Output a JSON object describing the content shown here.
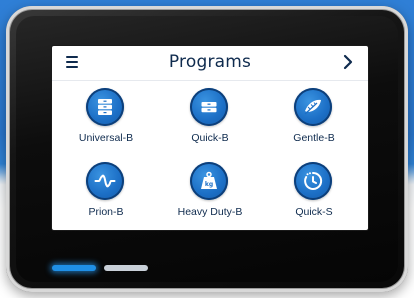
{
  "header": {
    "title": "Programs",
    "menu_icon": "menu-icon",
    "next_icon": "chevron-right-icon"
  },
  "programs": [
    {
      "label": "Universal-B",
      "icon": "universal-load-icon"
    },
    {
      "label": "Quick-B",
      "icon": "quick-load-icon"
    },
    {
      "label": "Gentle-B",
      "icon": "feather-icon"
    },
    {
      "label": "Prion-B",
      "icon": "prion-wave-icon"
    },
    {
      "label": "Heavy Duty-B",
      "icon": "weight-icon"
    },
    {
      "label": "Quick-S",
      "icon": "stopwatch-icon"
    }
  ],
  "page_indicator": {
    "pages": 2,
    "current": 1
  },
  "colors": {
    "accent": "#1c6fc6",
    "text": "#0f2b4e",
    "indicator_active": "#1f8fe6",
    "indicator_inactive": "#c9d0d8",
    "background_blue": "#2f7fd6"
  }
}
